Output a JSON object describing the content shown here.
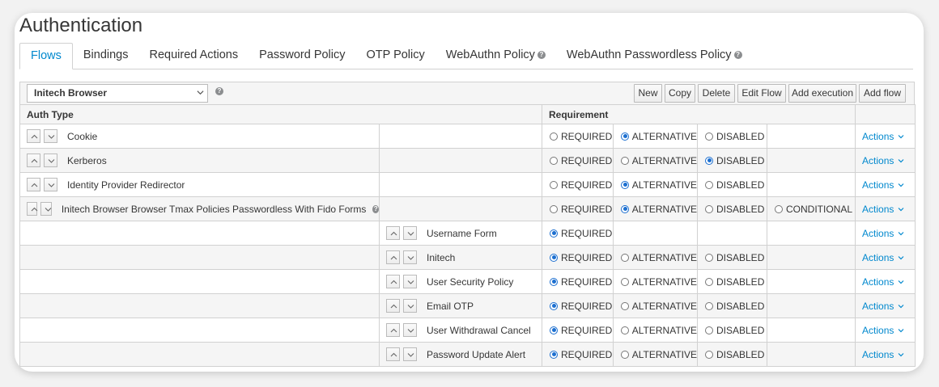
{
  "page": {
    "title": "Authentication"
  },
  "tabs": [
    {
      "label": "Flows",
      "active": true,
      "help": false
    },
    {
      "label": "Bindings",
      "active": false,
      "help": false
    },
    {
      "label": "Required Actions",
      "active": false,
      "help": false
    },
    {
      "label": "Password Policy",
      "active": false,
      "help": false
    },
    {
      "label": "OTP Policy",
      "active": false,
      "help": false
    },
    {
      "label": "WebAuthn Policy",
      "active": false,
      "help": true
    },
    {
      "label": "WebAuthn Passwordless Policy",
      "active": false,
      "help": true
    }
  ],
  "toolbar": {
    "selected_flow": "Initech Browser",
    "buttons": {
      "new": "New",
      "copy": "Copy",
      "delete": "Delete",
      "edit_flow": "Edit Flow",
      "add_execution": "Add execution",
      "add_flow": "Add flow"
    }
  },
  "table": {
    "headers": {
      "auth_type": "Auth Type",
      "requirement": "Requirement"
    },
    "labels": {
      "required": "REQUIRED",
      "alternative": "ALTERNATIVE",
      "disabled": "DISABLED",
      "conditional": "CONDITIONAL",
      "actions": "Actions"
    },
    "rows": [
      {
        "name": "Cookie",
        "level": 0,
        "help": false,
        "options": [
          "required",
          "alternative",
          "disabled"
        ],
        "selected": "alternative"
      },
      {
        "name": "Kerberos",
        "level": 0,
        "help": false,
        "options": [
          "required",
          "alternative",
          "disabled"
        ],
        "selected": "disabled"
      },
      {
        "name": "Identity Provider Redirector",
        "level": 0,
        "help": false,
        "options": [
          "required",
          "alternative",
          "disabled"
        ],
        "selected": "alternative"
      },
      {
        "name": "Initech Browser Browser Tmax Policies Passwordless With Fido Forms",
        "level": 0,
        "help": true,
        "options": [
          "required",
          "alternative",
          "disabled",
          "conditional"
        ],
        "selected": "alternative"
      },
      {
        "name": "Username Form",
        "level": 1,
        "help": false,
        "options": [
          "required"
        ],
        "selected": "required"
      },
      {
        "name": "Initech",
        "level": 1,
        "help": false,
        "options": [
          "required",
          "alternative",
          "disabled"
        ],
        "selected": "required"
      },
      {
        "name": "User Security Policy",
        "level": 1,
        "help": false,
        "options": [
          "required",
          "alternative",
          "disabled"
        ],
        "selected": "required"
      },
      {
        "name": "Email OTP",
        "level": 1,
        "help": false,
        "options": [
          "required",
          "alternative",
          "disabled"
        ],
        "selected": "required"
      },
      {
        "name": "User Withdrawal Cancel",
        "level": 1,
        "help": false,
        "options": [
          "required",
          "alternative",
          "disabled"
        ],
        "selected": "required"
      },
      {
        "name": "Password Update Alert",
        "level": 1,
        "help": false,
        "options": [
          "required",
          "alternative",
          "disabled"
        ],
        "selected": "required"
      }
    ]
  },
  "colors": {
    "accent": "#0088ce",
    "radio": "#1c6fd0",
    "border": "#d1d1d1"
  },
  "icons": {
    "help": "question-circle-icon",
    "up": "chevron-up-icon",
    "down": "chevron-down-icon"
  }
}
